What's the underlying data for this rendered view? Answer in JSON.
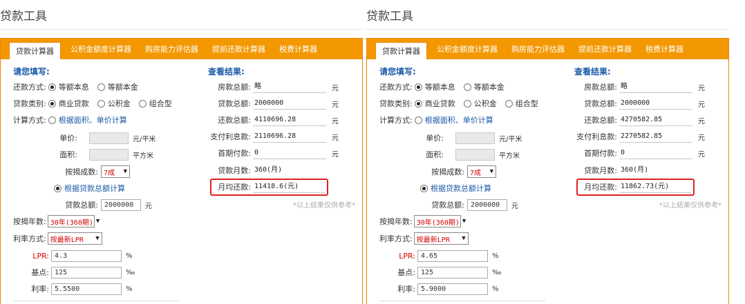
{
  "labels": {
    "section_title": "贷款工具",
    "tabs": [
      "贷款计算器",
      "公积金额度计算器",
      "购房能力评估器",
      "提前还款计算器",
      "税费计算器"
    ],
    "fill_in": "请您填写:",
    "results": "查看结果:",
    "repay_method": "还款方式:",
    "repay_opt1": "等额本息",
    "repay_opt2": "等额本金",
    "loan_type": "贷款类别:",
    "loan_opt1": "商业贷款",
    "loan_opt2": "公积金",
    "loan_opt3": "组合型",
    "calc_method": "计算方式:",
    "calc_by_area": "根据面积、单价计算",
    "unit_price": "单价:",
    "unit_price_unit": "元/平米",
    "area": "面积:",
    "area_unit": "平方米",
    "mortgage_ratio": "按揭成数:",
    "calc_by_total": "根据贷款总额计算",
    "loan_total": "贷款总额:",
    "yuan": "元",
    "mortgage_years": "按揭年数:",
    "rate_method": "利率方式:",
    "lpr": "LPR:",
    "basis_points": "基点:",
    "rate": "利率:",
    "pct": "%",
    "permille": "‰",
    "house_total": "房款总额:",
    "repay_total": "还款总额:",
    "interest_paid": "支付利息款:",
    "down_payment": "首期付款:",
    "loan_months": "贷款月数:",
    "monthly_repay": "月均还款:",
    "note": "*以上结果仅供参考*"
  },
  "panels": [
    {
      "inputs": {
        "mortgage_ratio": "7成",
        "loan_total": "2000000",
        "mortgage_years": "30年(360期)",
        "rate_method": "按最新LPR",
        "lpr": "4.3",
        "basis_points": "125",
        "rate": "5.5500"
      },
      "results": {
        "house_total": "略",
        "loan_total": "2000000",
        "repay_total": "4110696.28",
        "interest_paid": "2110696.28",
        "down_payment": "0",
        "loan_months": "360(月)",
        "monthly_repay": "11418.6(元)"
      }
    },
    {
      "inputs": {
        "mortgage_ratio": "7成",
        "loan_total": "2000000",
        "mortgage_years": "30年(360期)",
        "rate_method": "按最新LPR",
        "lpr": "4.65",
        "basis_points": "125",
        "rate": "5.9000"
      },
      "results": {
        "house_total": "略",
        "loan_total": "2000000",
        "repay_total": "4270582.85",
        "interest_paid": "2270582.85",
        "down_payment": "0",
        "loan_months": "360(月)",
        "monthly_repay": "11862.73(元)"
      }
    }
  ]
}
